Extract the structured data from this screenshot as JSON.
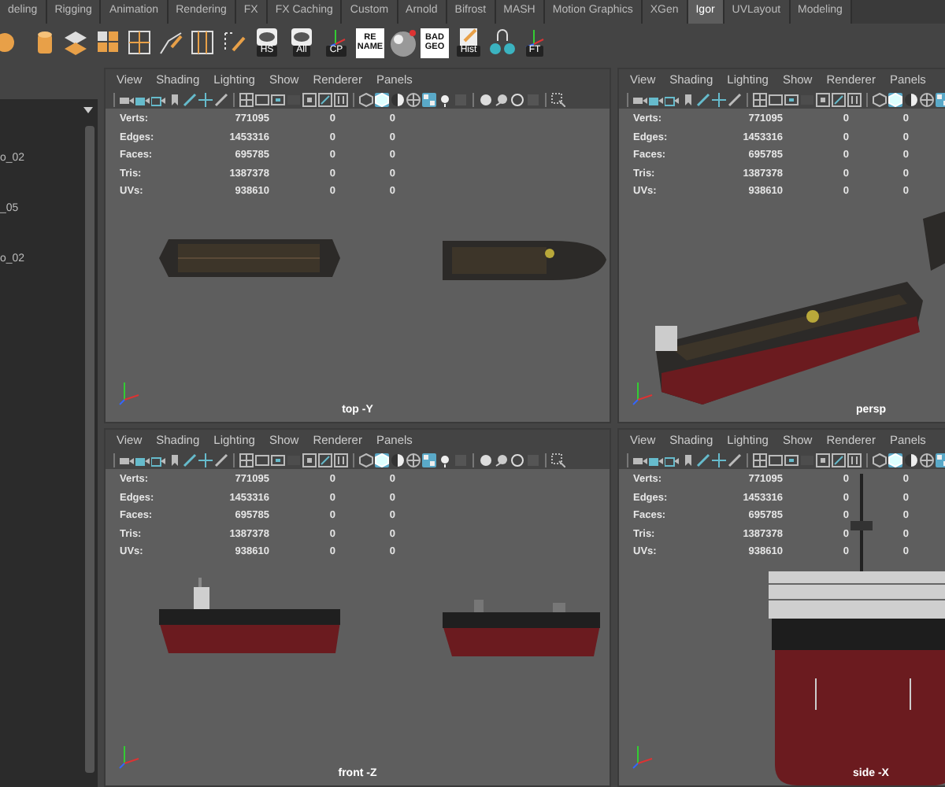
{
  "shelf_tabs": [
    {
      "label": "deling",
      "selected": false
    },
    {
      "label": "Rigging",
      "selected": false
    },
    {
      "label": "Animation",
      "selected": false
    },
    {
      "label": "Rendering",
      "selected": false
    },
    {
      "label": "FX",
      "selected": false
    },
    {
      "label": "FX Caching",
      "selected": false
    },
    {
      "label": "Custom",
      "selected": false
    },
    {
      "label": "Arnold",
      "selected": false
    },
    {
      "label": "Bifrost",
      "selected": false
    },
    {
      "label": "MASH",
      "selected": false
    },
    {
      "label": "Motion Graphics",
      "selected": false
    },
    {
      "label": "XGen",
      "selected": false
    },
    {
      "label": "Igor",
      "selected": true
    },
    {
      "label": "UVLayout",
      "selected": false
    },
    {
      "label": "Modeling",
      "selected": false
    }
  ],
  "shelf_icons": [
    {
      "kind": "ball"
    },
    {
      "kind": "cylinder"
    },
    {
      "kind": "tiles"
    },
    {
      "kind": "squares"
    },
    {
      "kind": "grid"
    },
    {
      "kind": "curve"
    },
    {
      "kind": "split"
    },
    {
      "kind": "dotted"
    },
    {
      "kind": "eye",
      "label": "HS"
    },
    {
      "kind": "eye",
      "label": "All"
    },
    {
      "kind": "axes",
      "label": "CP"
    },
    {
      "kind": "tile",
      "lines": [
        "RE",
        "NAME"
      ]
    },
    {
      "kind": "sphere"
    },
    {
      "kind": "tile",
      "lines": [
        "BAD",
        "GEO"
      ]
    },
    {
      "kind": "paper",
      "label": "Hist"
    },
    {
      "kind": "glasses"
    },
    {
      "kind": "axes",
      "label": "FT"
    }
  ],
  "outliner": {
    "items": [
      "o_02",
      "_05",
      "o_02"
    ]
  },
  "viewports": [
    {
      "menu": [
        "View",
        "Shading",
        "Lighting",
        "Show",
        "Renderer",
        "Panels"
      ],
      "toolbar_toggles": [
        false,
        false,
        false,
        false,
        false,
        false,
        false,
        false,
        false,
        false,
        false,
        false,
        false,
        false,
        false,
        true,
        false,
        false,
        true,
        false,
        false,
        false,
        false,
        false,
        false,
        false
      ],
      "stats": [
        {
          "label": "Verts:",
          "values": [
            "771095",
            "0",
            "0"
          ]
        },
        {
          "label": "Edges:",
          "values": [
            "1453316",
            "0",
            "0"
          ]
        },
        {
          "label": "Faces:",
          "values": [
            "695785",
            "0",
            "0"
          ]
        },
        {
          "label": "Tris:",
          "values": [
            "1387378",
            "0",
            "0"
          ]
        },
        {
          "label": "UVs:",
          "values": [
            "938610",
            "0",
            "0"
          ]
        }
      ],
      "kind": "top",
      "camera": "top -Y"
    },
    {
      "menu": [
        "View",
        "Shading",
        "Lighting",
        "Show",
        "Renderer",
        "Panels"
      ],
      "toolbar_toggles": [
        false,
        false,
        false,
        false,
        false,
        false,
        false,
        false,
        false,
        false,
        false,
        false,
        false,
        false,
        false,
        true,
        false,
        false,
        true
      ],
      "stats": [
        {
          "label": "Verts:",
          "values": [
            "771095",
            "0",
            "0"
          ]
        },
        {
          "label": "Edges:",
          "values": [
            "1453316",
            "0",
            "0"
          ]
        },
        {
          "label": "Faces:",
          "values": [
            "695785",
            "0",
            "0"
          ]
        },
        {
          "label": "Tris:",
          "values": [
            "1387378",
            "0",
            "0"
          ]
        },
        {
          "label": "UVs:",
          "values": [
            "938610",
            "0",
            "0"
          ]
        }
      ],
      "kind": "persp",
      "camera": "persp"
    },
    {
      "menu": [
        "View",
        "Shading",
        "Lighting",
        "Show",
        "Renderer",
        "Panels"
      ],
      "toolbar_toggles": [
        false,
        false,
        false,
        false,
        false,
        false,
        false,
        false,
        false,
        false,
        false,
        false,
        false,
        false,
        false,
        true,
        false,
        false,
        true,
        false,
        false,
        false,
        false,
        false,
        false,
        false
      ],
      "stats": [
        {
          "label": "Verts:",
          "values": [
            "771095",
            "0",
            "0"
          ]
        },
        {
          "label": "Edges:",
          "values": [
            "1453316",
            "0",
            "0"
          ]
        },
        {
          "label": "Faces:",
          "values": [
            "695785",
            "0",
            "0"
          ]
        },
        {
          "label": "Tris:",
          "values": [
            "1387378",
            "0",
            "0"
          ]
        },
        {
          "label": "UVs:",
          "values": [
            "938610",
            "0",
            "0"
          ]
        }
      ],
      "kind": "front",
      "camera": "front -Z"
    },
    {
      "menu": [
        "View",
        "Shading",
        "Lighting",
        "Show",
        "Renderer",
        "Panels"
      ],
      "toolbar_toggles": [
        false,
        false,
        false,
        false,
        false,
        false,
        false,
        false,
        false,
        false,
        false,
        false,
        false,
        false,
        false,
        true,
        false,
        false,
        true
      ],
      "stats": [
        {
          "label": "Verts:",
          "values": [
            "771095",
            "0",
            "0"
          ]
        },
        {
          "label": "Edges:",
          "values": [
            "1453316",
            "0",
            "0"
          ]
        },
        {
          "label": "Faces:",
          "values": [
            "695785",
            "0",
            "0"
          ]
        },
        {
          "label": "Tris:",
          "values": [
            "1387378",
            "0",
            "0"
          ]
        },
        {
          "label": "UVs:",
          "values": [
            "938610",
            "0",
            "0"
          ]
        }
      ],
      "kind": "side",
      "camera": "side -X"
    }
  ]
}
